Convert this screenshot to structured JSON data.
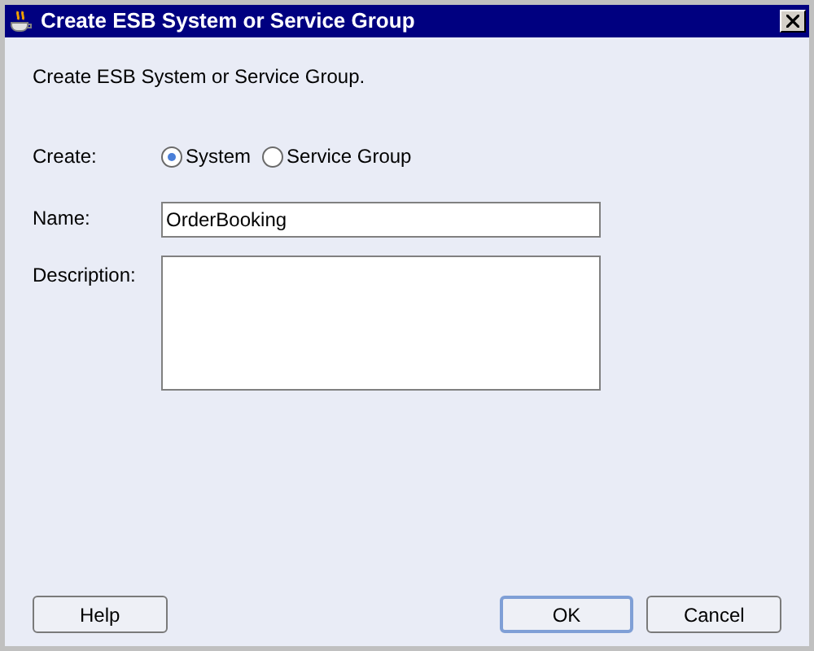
{
  "window": {
    "title": "Create ESB System or Service Group"
  },
  "intro": "Create ESB System or Service Group.",
  "create": {
    "label": "Create:",
    "options": [
      {
        "label": "System",
        "selected": true
      },
      {
        "label": "Service Group",
        "selected": false
      }
    ]
  },
  "name": {
    "label": "Name:",
    "value": "OrderBooking"
  },
  "description": {
    "label": "Description:"
  },
  "buttons": [
    {
      "label": "Help",
      "default": false
    },
    {
      "label": "OK",
      "default": true
    },
    {
      "label": "Cancel",
      "default": false
    }
  ]
}
